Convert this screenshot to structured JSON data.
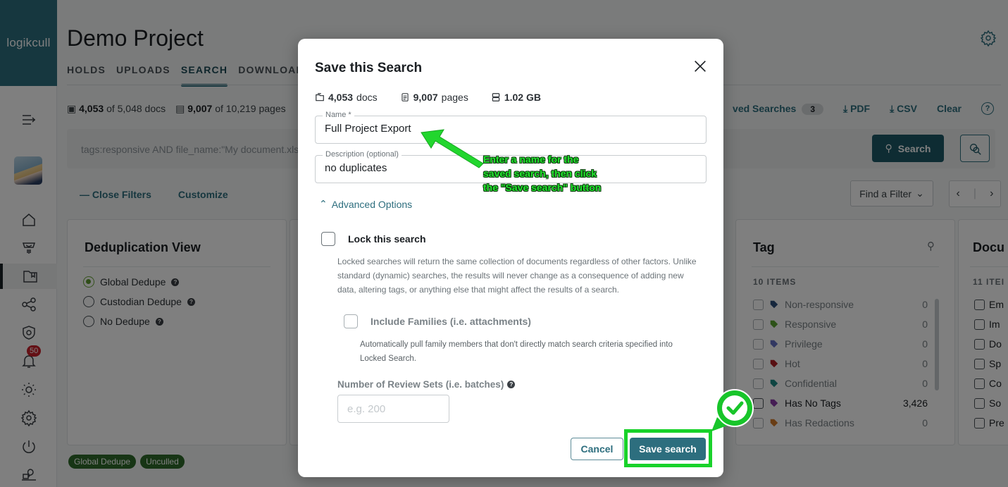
{
  "app": {
    "logo_text": "logikcull",
    "project_title": "Demo Project",
    "nav_tabs": [
      {
        "label": "HOLDS",
        "active": false
      },
      {
        "label": "UPLOADS",
        "active": false
      },
      {
        "label": "SEARCH",
        "active": true
      },
      {
        "label": "DOWNLOADS",
        "active": false
      }
    ],
    "sidebar": {
      "items": [
        {
          "icon": "menu-expand-icon"
        },
        {
          "icon": "home-icon"
        },
        {
          "icon": "holds-icon"
        },
        {
          "icon": "search-folder-icon",
          "active": true
        },
        {
          "icon": "share-icon"
        },
        {
          "icon": "shield-gear-icon"
        },
        {
          "icon": "bell-icon",
          "badge": "50"
        },
        {
          "icon": "sun-icon"
        },
        {
          "icon": "gear-icon"
        },
        {
          "icon": "power-icon"
        },
        {
          "icon": "help-desk-icon"
        }
      ]
    },
    "stats": {
      "docs_bold": "4,053",
      "docs_rest": "of 5,048 docs",
      "pages_bold": "9,007",
      "pages_rest": "of 10,219 pages"
    },
    "toolbar": {
      "saved_searches_label": "ved Searches",
      "saved_searches_count": "3",
      "pdf_label": "PDF",
      "csv_label": "CSV",
      "clear_label": "Clear"
    },
    "search": {
      "query": "tags:responsive AND file_name:\"My document.xls\"",
      "search_button": "Search"
    },
    "filters": {
      "close_filters": "Close Filters",
      "customize": "Customize",
      "find_filter": "Find a Filter"
    },
    "dedupe_card": {
      "title": "Deduplication View",
      "options": [
        {
          "label": "Global Dedupe",
          "selected": true
        },
        {
          "label": "Custodian Dedupe",
          "selected": false
        },
        {
          "label": "No Dedupe",
          "selected": false
        }
      ]
    },
    "tag_card": {
      "title": "Tag",
      "items_count": "10 ITEMS",
      "items": [
        {
          "label": "Non-responsive",
          "count": "0",
          "color": "#2d4f7a"
        },
        {
          "label": "Responsive",
          "count": "0",
          "color": "#5aa531"
        },
        {
          "label": "Privilege",
          "count": "0",
          "color": "#6471c4"
        },
        {
          "label": "Hot",
          "count": "0",
          "color": "#b01e24"
        },
        {
          "label": "Confidential",
          "count": "0",
          "color": "#1d8b84"
        },
        {
          "label": "Has No Tags",
          "count": "3,426",
          "color": "#8a3aa8"
        },
        {
          "label": "Has Redactions",
          "count": "0",
          "color": "#d37a2a"
        }
      ]
    },
    "doc_card": {
      "title": "Docu",
      "items_count": "11 ITEI",
      "items": [
        "Em",
        "Im",
        "Do",
        "Sp",
        "Co",
        "So",
        "Pre"
      ]
    },
    "chips": [
      "Global Dedupe",
      "Unculled"
    ]
  },
  "modal": {
    "title": "Save this Search",
    "stats": {
      "docs_bold": "4,053",
      "docs_rest": "docs",
      "pages_bold": "9,007",
      "pages_rest": "pages",
      "size": "1.02 GB"
    },
    "name_field": {
      "label": "Name *",
      "value": "Full Project Export"
    },
    "description_field": {
      "label": "Description (optional)",
      "value": "no duplicates"
    },
    "advanced_options": "Advanced Options",
    "lock_search": {
      "label": "Lock this search",
      "checked": false,
      "description": "Locked searches will return the same collection of documents regardless of other factors. Unlike standard (dynamic) searches, the results will never change as a consequence of adding new data, altering tags, or anything else that might affect the results of a search."
    },
    "include_families": {
      "label": "Include Families (i.e. attachments)",
      "checked": false,
      "description": "Automatically pull family members that don't directly match search criteria specified into Locked Search."
    },
    "review_sets": {
      "label": "Number of Review Sets (i.e. batches)",
      "placeholder": "e.g. 200",
      "value": ""
    },
    "cancel_button": "Cancel",
    "save_button": "Save search"
  },
  "annotation": {
    "text": "Enter a name for the\nsaved search, then click\nthe \"Save search\" button",
    "color": "#22e52e"
  }
}
